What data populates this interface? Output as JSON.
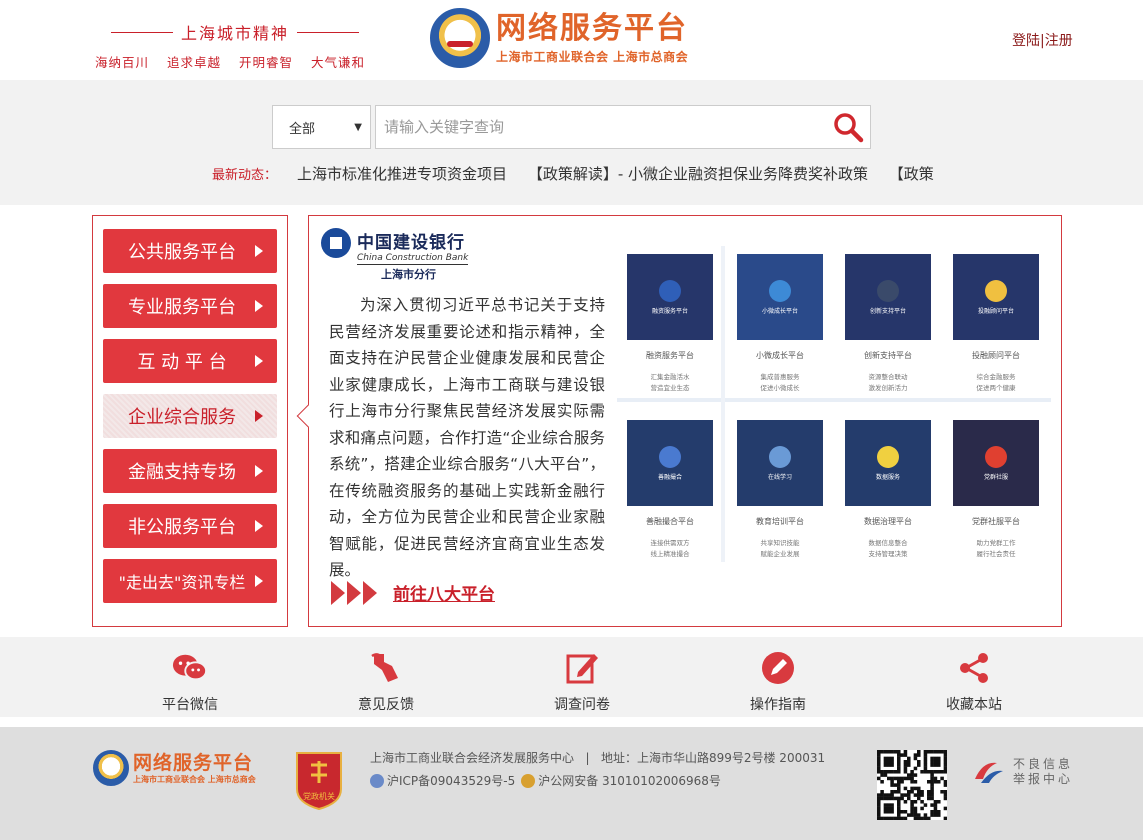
{
  "header": {
    "spirit_title": "上海城市精神",
    "spirit_values": [
      "海纳百川",
      "追求卓越",
      "开明睿智",
      "大气谦和"
    ],
    "logo_title": "网络服务平台",
    "logo_subtitle": "上海市工商业联合会 上海市总商会",
    "login_label": "登陆",
    "separator": "|",
    "register_label": "注册"
  },
  "search": {
    "scope_value": "全部",
    "placeholder": "请输入关键字查询"
  },
  "news": {
    "label": "最新动态：",
    "items": [
      "上海市标准化推进专项资金项目",
      "【政策解读】- 小微企业融资担保业务降费奖补政策",
      "【政策"
    ]
  },
  "sidebar": {
    "items": [
      {
        "label": "公共服务平台"
      },
      {
        "label": "专业服务平台"
      },
      {
        "label": "互 动 平 台"
      },
      {
        "label": "企业综合服务"
      },
      {
        "label": "金融支持专场"
      },
      {
        "label": "非公服务平台"
      },
      {
        "label": "\"走出去\"资讯专栏"
      }
    ]
  },
  "panel": {
    "bank_name_cn": "中国建设银行",
    "bank_name_en": "China Construction Bank",
    "bank_branch": "上海市分行",
    "intro": "为深入贯彻习近平总书记关于支持民营经济发展重要论述和指示精神，全面支持在沪民营企业健康发展和民营企业家健康成长，上海市工商联与建设银行上海市分行聚焦民营经济发展实际需求和痛点问题，合作打造“企业综合服务系统”，搭建企业综合服务“八大平台”，在传统融资服务的基础上实践新金融行动，全方位为民营企业和民营企业家融智赋能，促进民营经济宜商宜业生态发展。",
    "goto_label": "前往八大平台",
    "tiles": [
      {
        "mini": "融资服务平台",
        "name": "融资服务平台",
        "desc1": "汇集金融活水",
        "desc2": "营造宜业生态",
        "color": "#2f5fb8"
      },
      {
        "mini": "小微成长平台",
        "name": "小微成长平台",
        "desc1": "集成普惠服务",
        "desc2": "促进小微成长",
        "color": "#3d8ad6"
      },
      {
        "mini": "创新支持平台",
        "name": "创新支持平台",
        "desc1": "资源整合联动",
        "desc2": "激发创新活力",
        "color": "#3a4a6a"
      },
      {
        "mini": "投融顾问平台",
        "name": "投融顾问平台",
        "desc1": "综合金融服务",
        "desc2": "促进两个健康",
        "color": "#f0c040"
      },
      {
        "mini": "善融撮合",
        "name": "善融撮合平台",
        "desc1": "连接供需双方",
        "desc2": "线上精准撮合",
        "color": "#4a7ad0"
      },
      {
        "mini": "在线学习",
        "name": "教育培训平台",
        "desc1": "共享知识技能",
        "desc2": "赋能企业发展",
        "color": "#6a9ad6"
      },
      {
        "mini": "数据服务",
        "name": "数据治理平台",
        "desc1": "数据信息整合",
        "desc2": "支持管理决策",
        "color": "#f0d040"
      },
      {
        "mini": "党群社服",
        "name": "党群社服平台",
        "desc1": "助力党群工作",
        "desc2": "履行社会责任",
        "color": "#e04030"
      }
    ]
  },
  "tools": [
    {
      "label": "平台微信",
      "icon": "wechat-icon"
    },
    {
      "label": "意见反馈",
      "icon": "feedback-icon"
    },
    {
      "label": "调查问卷",
      "icon": "survey-icon"
    },
    {
      "label": "操作指南",
      "icon": "guide-icon"
    },
    {
      "label": "收藏本站",
      "icon": "share-icon"
    }
  ],
  "footer": {
    "logo_title": "网络服务平台",
    "logo_subtitle": "上海市工商业联合会 上海市总商会",
    "badge_label": "党政机关",
    "org": "上海市工商业联合会经济发展服务中心",
    "address": "地址：上海市华山路899号2号楼 200031",
    "icp": "沪ICP备09043529号-5",
    "police": "沪公网安备 31010102006968号",
    "report_line1": "不良信息",
    "report_line2": "举报中心"
  },
  "colors": {
    "brand_red": "#e1383e",
    "brand_orange": "#e0642a",
    "brand_blue": "#2b5ca8"
  }
}
